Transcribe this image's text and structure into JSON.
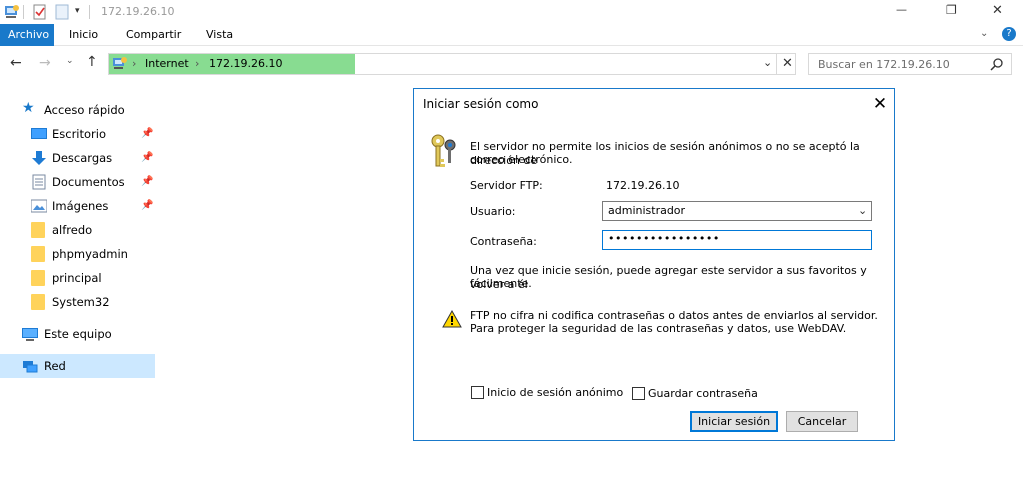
{
  "window": {
    "title": "172.19.26.10",
    "controls": {
      "minimize": "—",
      "restore": "❐",
      "close": "✕"
    }
  },
  "ribbon": {
    "tabs": [
      {
        "label": "Archivo",
        "active": true
      },
      {
        "label": "Inicio",
        "active": false
      },
      {
        "label": "Compartir",
        "active": false
      },
      {
        "label": "Vista",
        "active": false
      }
    ],
    "help": "?"
  },
  "navigation": {
    "address": {
      "crumbs": [
        "Internet",
        "172.19.26.10"
      ]
    },
    "search": {
      "placeholder": "Buscar en 172.19.26.10"
    }
  },
  "sidebar": {
    "quick_access": "Acceso rápido",
    "items": [
      {
        "label": "Escritorio",
        "icon": "desktop-icon",
        "pinned": true
      },
      {
        "label": "Descargas",
        "icon": "download-arrow-icon",
        "pinned": true
      },
      {
        "label": "Documentos",
        "icon": "documents-icon",
        "pinned": true
      },
      {
        "label": "Imágenes",
        "icon": "pictures-icon",
        "pinned": true
      },
      {
        "label": "alfredo",
        "icon": "folder-icon",
        "pinned": false
      },
      {
        "label": "phpmyadmin",
        "icon": "folder-icon",
        "pinned": false
      },
      {
        "label": "principal",
        "icon": "folder-icon",
        "pinned": false
      },
      {
        "label": "System32",
        "icon": "folder-icon",
        "pinned": false
      }
    ],
    "this_pc": "Este equipo",
    "network": "Red"
  },
  "dialog": {
    "title": "Iniciar sesión como",
    "message_line1": "El servidor no permite los inicios de sesión anónimos o no se aceptó la dirección de",
    "message_line2": "correo electrónico.",
    "server_label": "Servidor FTP:",
    "server_value": "172.19.26.10",
    "user_label": "Usuario:",
    "user_value": "administrador",
    "password_label": "Contraseña:",
    "password_value": "••••••••••••••••",
    "info_line1": "Una vez que inicie sesión, puede agregar este servidor a sus favoritos y volver a él",
    "info_line2": "fácilmente.",
    "warning_line1": "FTP no cifra ni codifica contraseñas o datos antes de enviarlos al servidor.",
    "warning_line2": "Para proteger la seguridad de las contraseñas y datos, use WebDAV.",
    "anonymous_label": "Inicio de sesión anónimo",
    "save_password_label": "Guardar contraseña",
    "login_button": "Iniciar sesión",
    "cancel_button": "Cancelar",
    "anonymous_checked": false,
    "save_password_checked": false
  },
  "colors": {
    "accent": "#1979ca",
    "address_highlight": "#88dc91",
    "selected_nav": "#cce8ff",
    "folder": "#ffd35b"
  }
}
